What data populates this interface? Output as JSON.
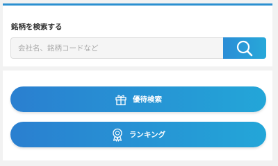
{
  "search": {
    "title": "銘柄を検索する",
    "placeholder": "会社名、銘柄コードなど",
    "value": "",
    "button_icon": "search-icon"
  },
  "menu": {
    "buttons": [
      {
        "label": "優待検索",
        "icon": "gift-icon"
      },
      {
        "label": "ランキング",
        "icon": "award-medal-icon"
      }
    ]
  },
  "colors": {
    "accent_bar": "#2b8fd0",
    "button_gradient_start": "#2a7fd0",
    "button_gradient_end": "#23a6d8",
    "background": "#f2f2f2"
  }
}
